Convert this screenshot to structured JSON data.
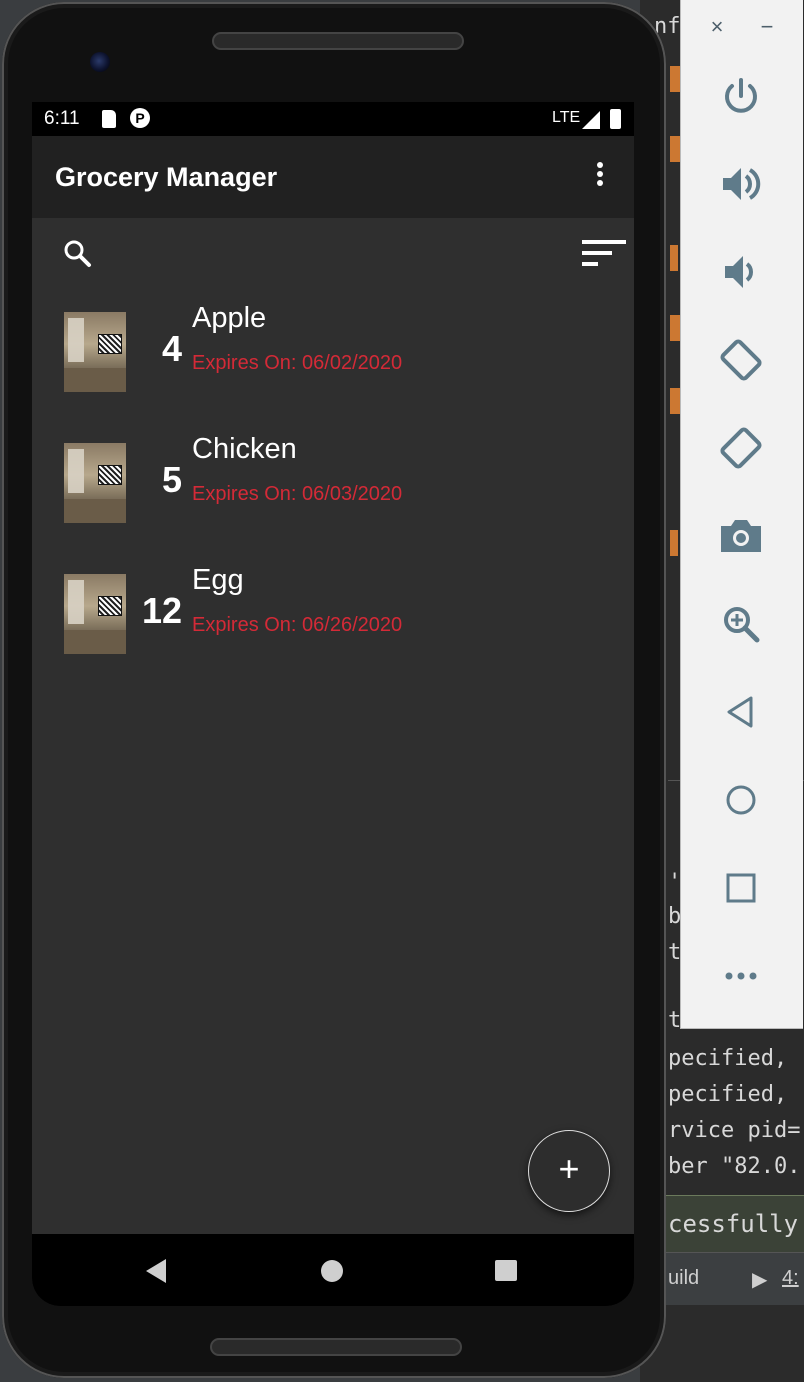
{
  "status_bar": {
    "time": "6:11",
    "network": "LTE",
    "p_glyph": "P"
  },
  "app": {
    "title": "Grocery Manager"
  },
  "groceries": [
    {
      "quantity": "4",
      "name": "Apple",
      "expires": "Expires On: 06/02/2020"
    },
    {
      "quantity": "5",
      "name": "Chicken",
      "expires": "Expires On: 06/03/2020"
    },
    {
      "quantity": "12",
      "name": "Egg",
      "expires": "Expires On: 06/26/2020"
    }
  ],
  "fab_symbol": "+",
  "emulator_toolbar": {
    "close_glyph": "×",
    "minimize_glyph": "−",
    "buttons": [
      "power-icon",
      "volume-up-icon",
      "volume-down-icon",
      "rotate-left-icon",
      "rotate-right-icon",
      "camera-icon",
      "zoom-icon",
      "back-icon",
      "home-icon",
      "overview-icon",
      "more-icon"
    ]
  },
  "ide_background": {
    "lines": [
      "nf",
      "'",
      "b",
      "t",
      "tion\" This",
      "pecified,",
      "pecified,",
      "rvice pid=",
      "ber \"82.0."
    ],
    "status_message": "cessfully fi",
    "tab_build": "uild",
    "tab_run": "4:"
  },
  "colors": {
    "app_bar": "#212121",
    "screen_bg": "#2f2f2f",
    "expires_text": "#d42a37",
    "toolbar_icon": "#5f7b8a"
  }
}
